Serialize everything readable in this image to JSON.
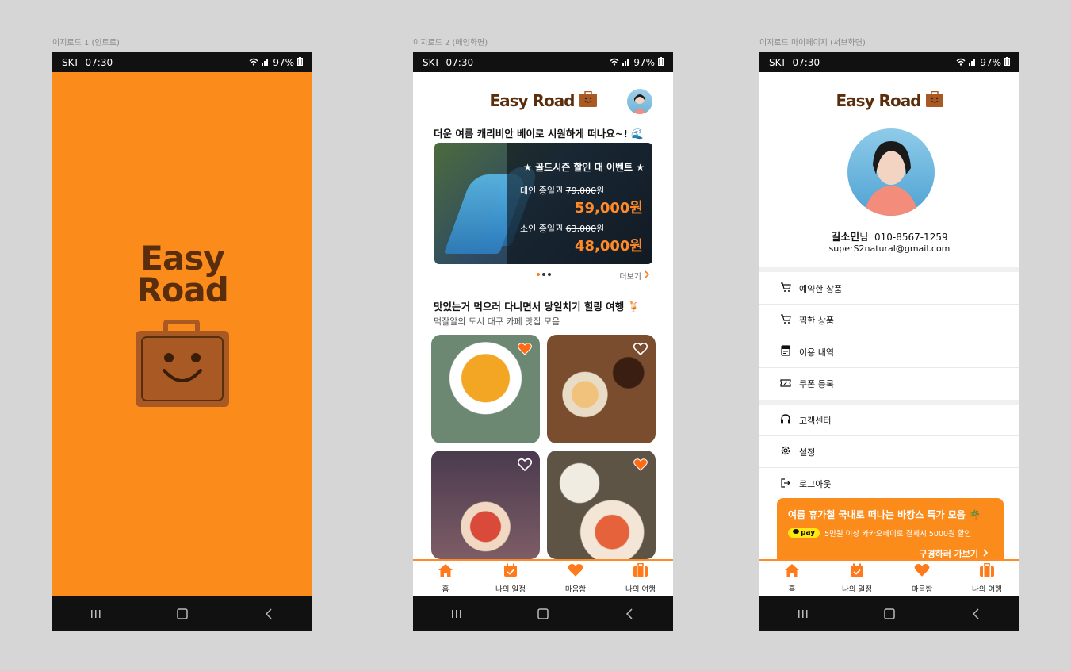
{
  "frames": {
    "intro_label": "이지로드 1 (인트로)",
    "main_label": "이지로드 2 (메인화면)",
    "mypage_label": "이지로드 마이페이지 (서브화면)"
  },
  "status": {
    "carrier": "SKT",
    "time": "07:30",
    "battery": "97%"
  },
  "brand": {
    "name": "Easy Road",
    "line1": "Easy",
    "line2": "Road",
    "orange": "#fb8c1c",
    "brown": "#5a2e0c",
    "accent": "#ff7a1a"
  },
  "main": {
    "section1_title": "더운 여름 캐리비안 베이로 시원하게 떠나요~! 🌊",
    "banner": {
      "event_title": "골드시즌 할인 대 이벤트",
      "adult_label": "대인 종일권",
      "adult_old_price": "79,000",
      "adult_old_unit": "원",
      "adult_price": "59,000원",
      "child_label": "소인 종일권",
      "child_old_price": "63,000",
      "child_old_unit": "원",
      "child_price": "48,000원"
    },
    "more_label": "더보기",
    "section2_title": "맛있는거 먹으러 다니면서 당일치기 힐링 여행 🍹",
    "section2_sub": "먹잘알의 도시 대구 카페 맛집 모음",
    "photos": [
      {
        "liked": true
      },
      {
        "liked": false
      },
      {
        "liked": false
      },
      {
        "liked": true
      }
    ]
  },
  "tabs": [
    {
      "label": "홈",
      "icon": "home-icon"
    },
    {
      "label": "나의 일정",
      "icon": "calendar-icon"
    },
    {
      "label": "마음함",
      "icon": "heart-icon"
    },
    {
      "label": "나의 여행",
      "icon": "suitcase-icon"
    }
  ],
  "profile": {
    "name": "길소민",
    "honorific": "님",
    "phone": "010-8567-1259",
    "email": "superS2natural@gmail.com"
  },
  "menu": [
    {
      "label": "예약한 상품",
      "icon": "cart-icon"
    },
    {
      "label": "찜한 상품",
      "icon": "cart-icon"
    },
    {
      "label": "이용 내역",
      "icon": "receipt-icon"
    },
    {
      "label": "쿠폰 등록",
      "icon": "coupon-icon"
    },
    {
      "label": "고객센터",
      "icon": "headset-icon"
    },
    {
      "label": "설정",
      "icon": "gear-icon"
    },
    {
      "label": "로그아웃",
      "icon": "logout-icon"
    }
  ],
  "promo": {
    "title": "여름 휴가철 국내로 떠나는 바캉스 특가 모음 🌴",
    "pay_badge": "pay",
    "pay_text": "5만원 이상 카카오페이로 결제시 5000원 할인",
    "cta": "구경하러 가보기"
  }
}
